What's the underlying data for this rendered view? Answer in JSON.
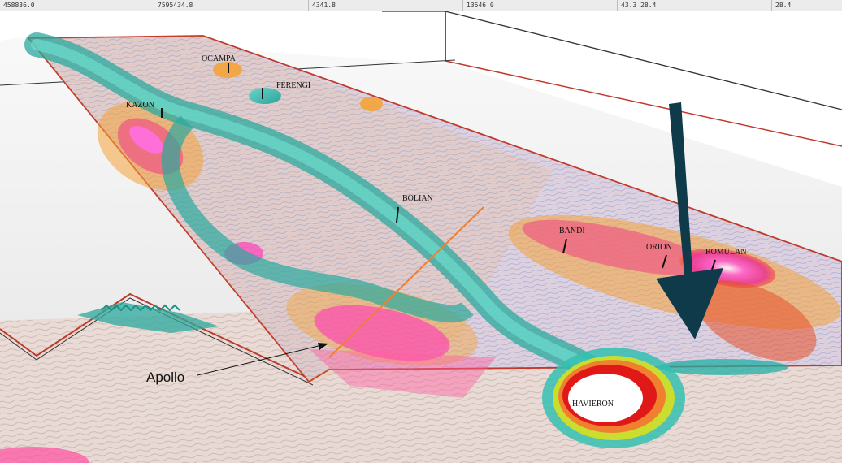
{
  "status_bar": {
    "fields": [
      "458836.0",
      "7595434.8",
      "4341.8",
      "13546.0",
      "43.3 28.4",
      "28.4"
    ]
  },
  "scene": {
    "targets": [
      "OCAMPA",
      "FERENGI",
      "KAZON",
      "BOLIAN",
      "BANDI",
      "ORION",
      "ROMULAN",
      "HAVIERON"
    ],
    "callout_label": "Apollo"
  },
  "colors": {
    "ground": "#f1f1f1",
    "section_outline": "#c0392b",
    "frame_line": "#333333",
    "teal_body": "#34bfb2",
    "pink_core": "#ff3fb8",
    "orange_halo": "#f4a33a",
    "arrow": "#0f3a4a",
    "drill_trace": "#f08030"
  }
}
